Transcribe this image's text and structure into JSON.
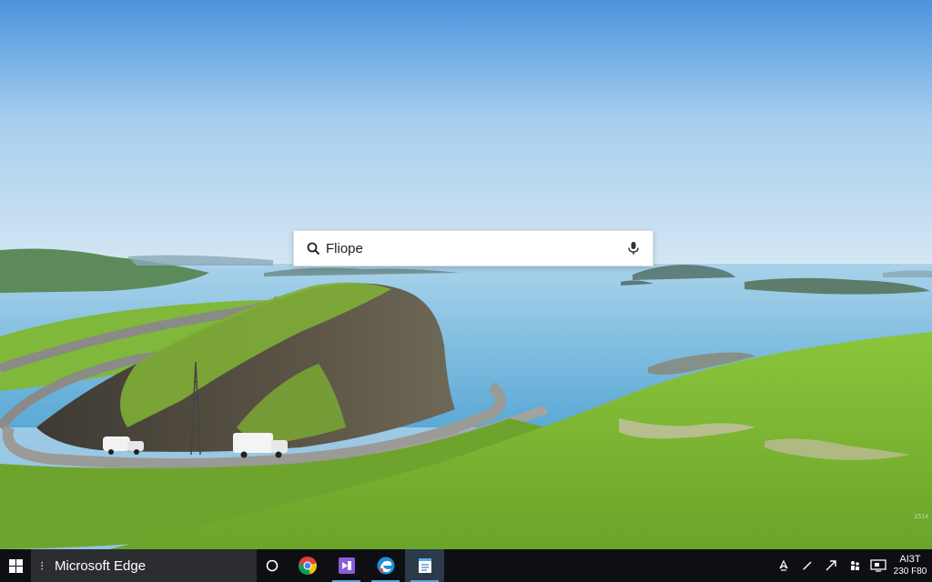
{
  "search": {
    "query": "Fliope"
  },
  "taskbar": {
    "search_label": "Microsoft Edge",
    "apps": [
      {
        "name": "Chrome",
        "icon": "chrome-icon",
        "active": false
      },
      {
        "name": "Visual Studio",
        "icon": "visual-studio-icon",
        "active": false
      },
      {
        "name": "Edge",
        "icon": "edge-icon",
        "active": false
      },
      {
        "name": "Notepad",
        "icon": "notepad-icon",
        "active": true
      }
    ],
    "tray_icons": [
      "network-icon",
      "pen-icon",
      "send-icon",
      "people-icon",
      "display-icon"
    ],
    "clock": {
      "time": "AI3T",
      "date": "230 F80"
    }
  },
  "wallpaper": {
    "corner_mark": "1514"
  },
  "colors": {
    "taskbar_bg": "#0d0f13",
    "taskbar_search_bg": "#2b2d31",
    "accent": "#5aa2e0",
    "grass": "#7cb934",
    "water": "#7dbde0"
  }
}
